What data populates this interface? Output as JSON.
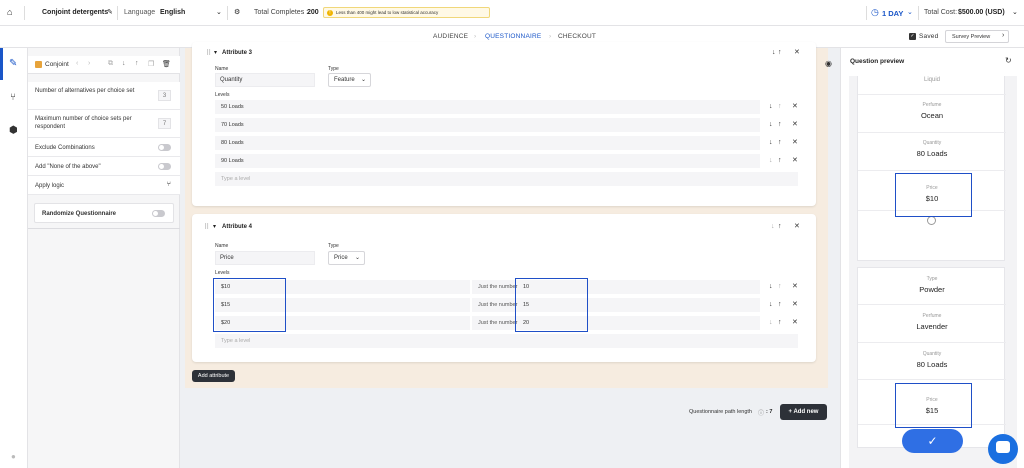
{
  "topbar": {
    "survey_name": "Conjoint detergents",
    "language_label": "Language",
    "language_value": "English",
    "total_completes_label": "Total Completes :",
    "total_completes_value": "200",
    "warning_text": "Less than 400 might lead to low statistical accuracy",
    "duration": "1 DAY",
    "total_cost_label": "Total Cost:",
    "total_cost_value": "$500.00 (USD)"
  },
  "tabs": [
    {
      "label": "AUDIENCE"
    },
    {
      "label": "QUESTIONNAIRE"
    },
    {
      "label": "CHECKOUT"
    }
  ],
  "saved_label": "Saved",
  "survey_preview_label": "Survey Preview",
  "left_panel": {
    "question_type": "Conjoint",
    "alternatives_label": "Number of alternatives per choice set",
    "alternatives_value": "3",
    "max_sets_label": "Maximum number of choice sets per respondent",
    "max_sets_value": "7",
    "exclude_label": "Exclude Combinations",
    "none_label": "Add \"None of the above\"",
    "apply_logic_label": "Apply logic",
    "randomize_label": "Randomize Questionnaire"
  },
  "attributes": [
    {
      "title": "Attribute 3",
      "name_label": "Name",
      "name_value": "Quantity",
      "type_label": "Type",
      "type_value": "Feature",
      "levels_label": "Levels",
      "levels": [
        "50 Loads",
        "70 Loads",
        "80 Loads",
        "90 Loads"
      ],
      "placeholder": "Type a level"
    },
    {
      "title": "Attribute 4",
      "name_label": "Name",
      "name_value": "Price",
      "type_label": "Type",
      "type_value": "Price",
      "levels_label": "Levels",
      "levels": [
        "$10",
        "$15",
        "$20"
      ],
      "number_label": "Just the number",
      "numbers": [
        "10",
        "15",
        "20"
      ],
      "placeholder": "Type a level"
    }
  ],
  "add_attribute_label": "Add attribute",
  "path_length_label": "Questionnaire path length",
  "path_length_value": ": 7",
  "add_new_label": "+ Add new",
  "preview": {
    "title": "Question preview",
    "partial_top": "Liquid",
    "card1": [
      {
        "key": "Perfume",
        "value": "Ocean"
      },
      {
        "key": "Quantity",
        "value": "80 Loads"
      },
      {
        "key": "Price",
        "value": "$10"
      }
    ],
    "card2": [
      {
        "key": "Type",
        "value": "Powder"
      },
      {
        "key": "Perfume",
        "value": "Lavender"
      },
      {
        "key": "Quantity",
        "value": "80 Loads"
      },
      {
        "key": "Price",
        "value": "$15"
      }
    ]
  },
  "colors": {
    "accent": "#1a56c8",
    "highlight_box": "#1f4fc7",
    "submit_button": "#2f6fe4"
  }
}
